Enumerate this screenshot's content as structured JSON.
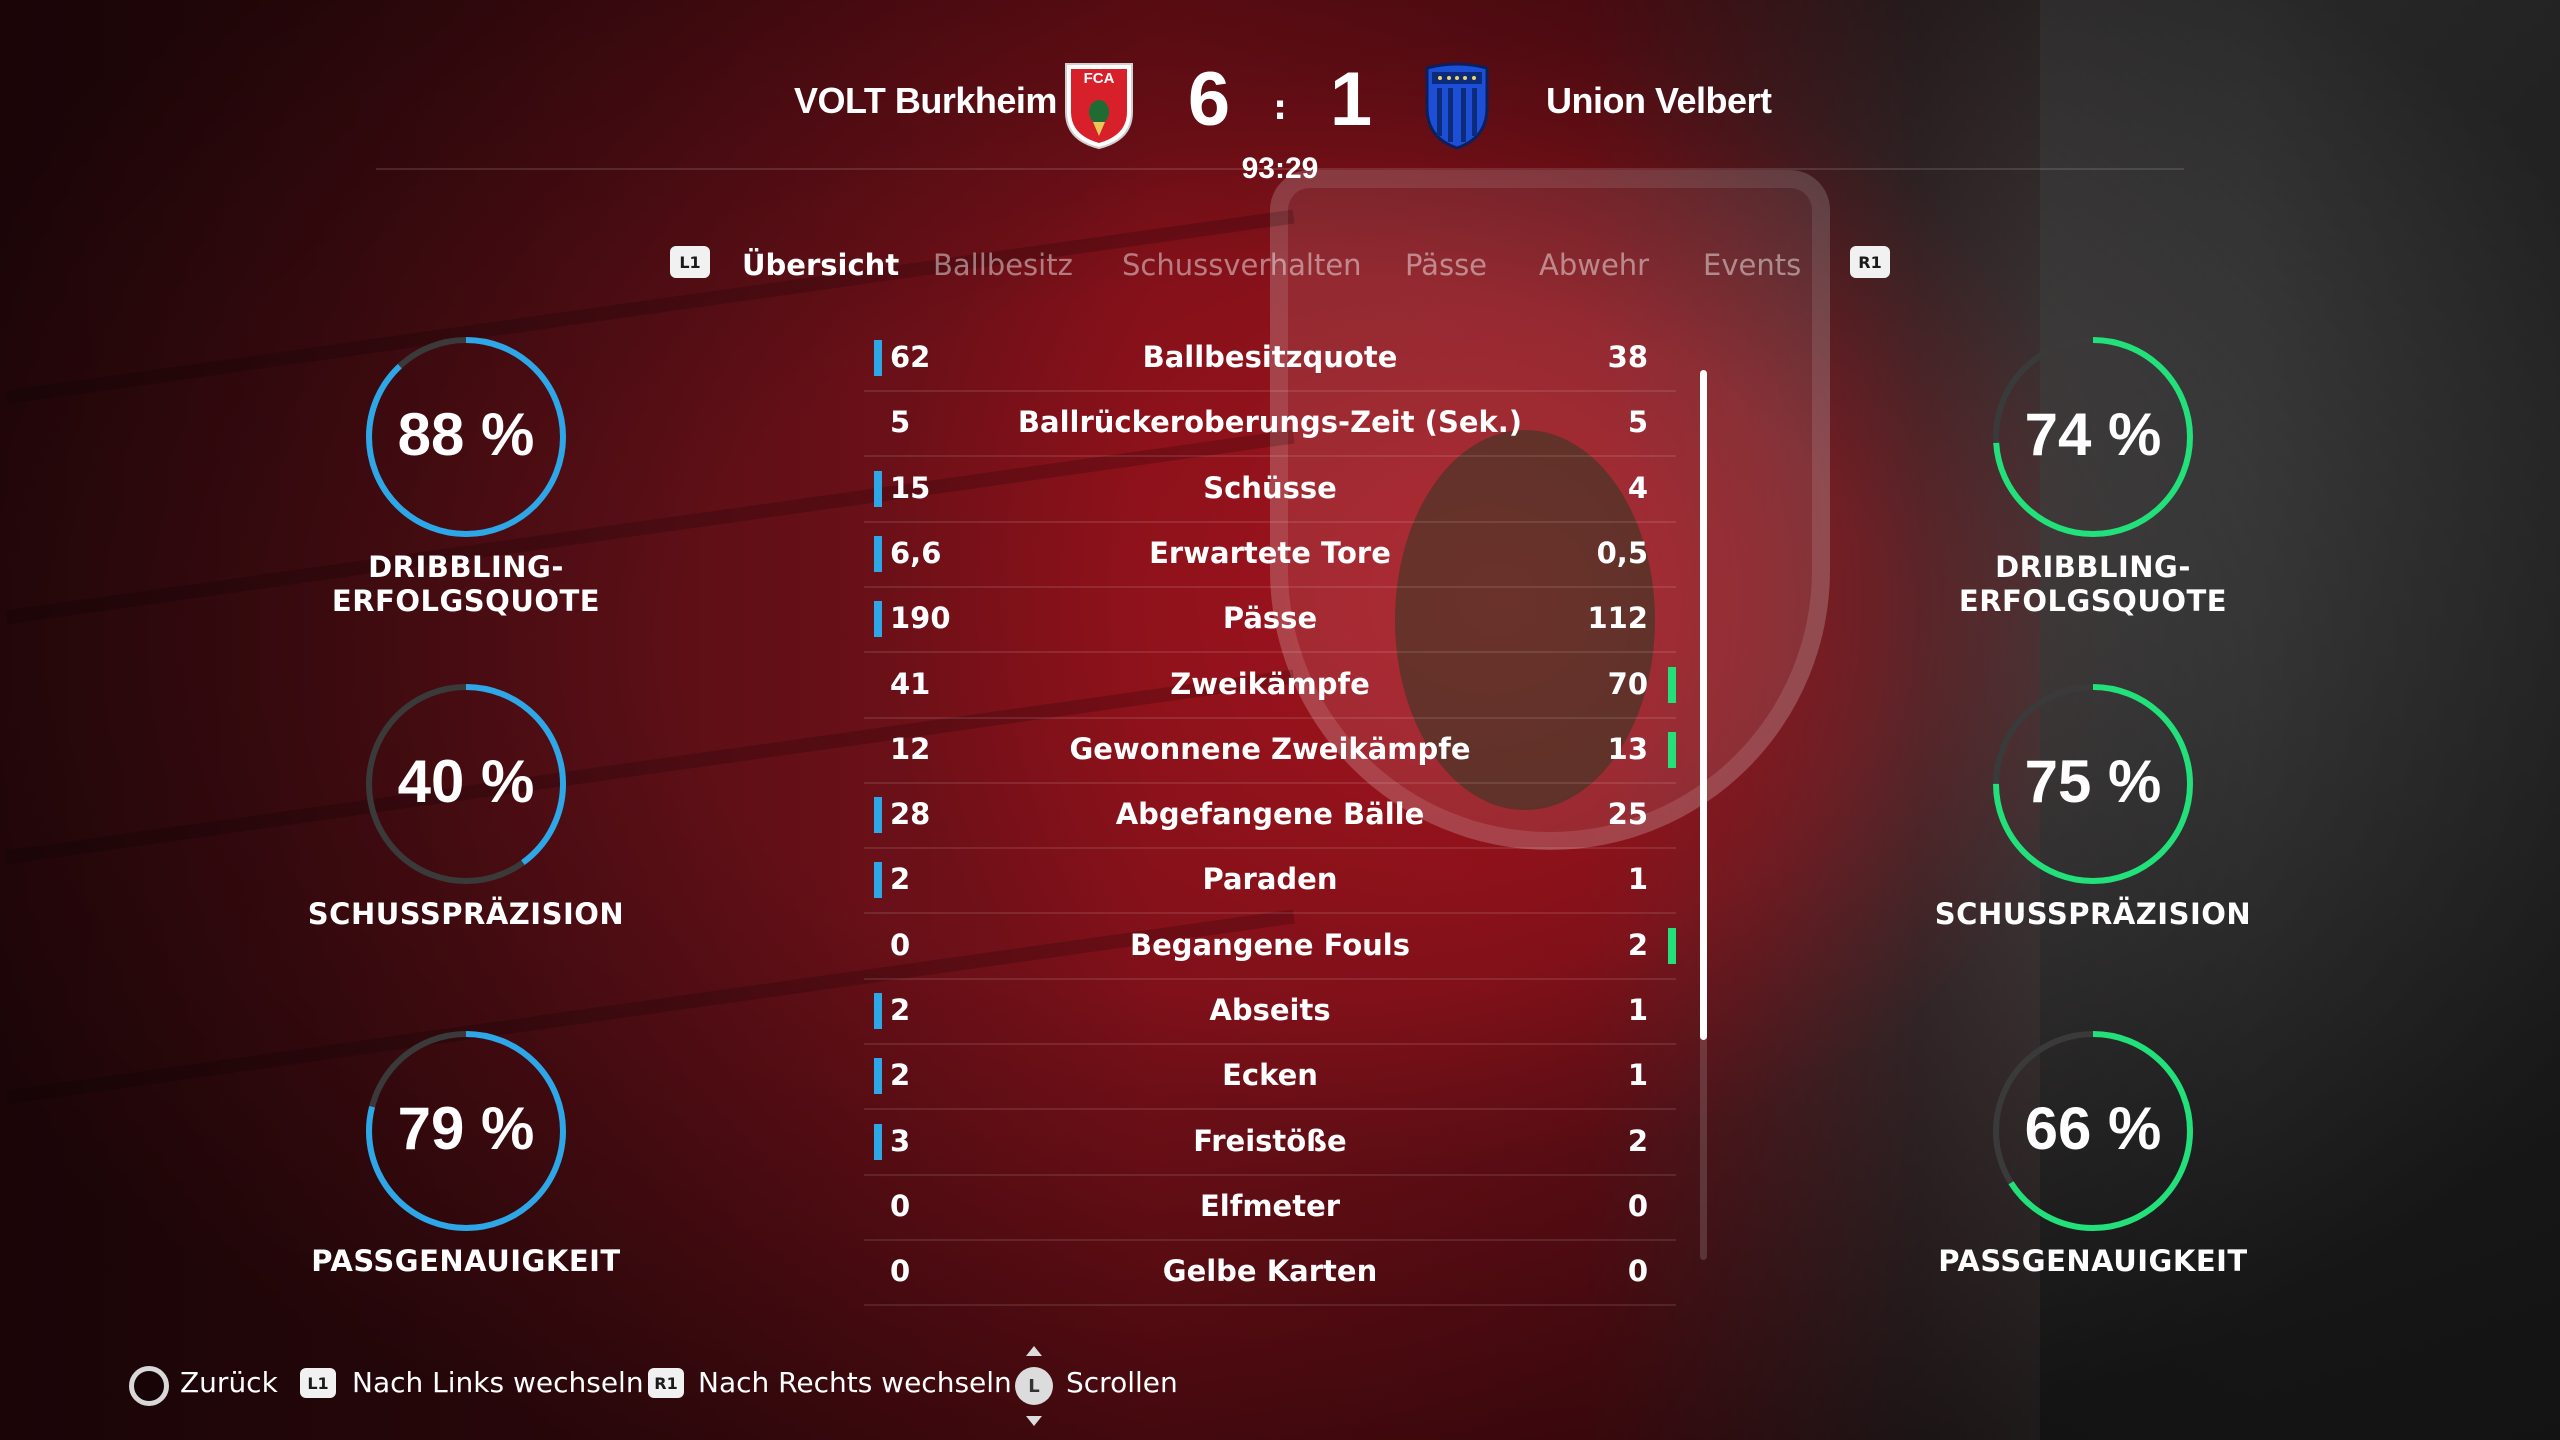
{
  "match": {
    "home_team": "VOLT Burkheim",
    "away_team": "Union Velbert",
    "home_score": "6",
    "away_score": "1",
    "separator": ":",
    "clock": "93:29",
    "home_crest_text": "FCA"
  },
  "tabs": {
    "left_button": "L1",
    "right_button": "R1",
    "items": [
      "Übersicht",
      "Ballbesitz",
      "Schussverhalten",
      "Pässe",
      "Abwehr",
      "Events"
    ],
    "active": "Übersicht"
  },
  "home_gauges": [
    {
      "value": "88 %",
      "percent": 88,
      "label": "DRIBBLING-ERFOLGSQUOTE"
    },
    {
      "value": "40 %",
      "percent": 40,
      "label": "SCHUSSPRÄZISION"
    },
    {
      "value": "79 %",
      "percent": 79,
      "label": "PASSGENAUIGKEIT"
    }
  ],
  "away_gauges": [
    {
      "value": "74 %",
      "percent": 74,
      "label": "DRIBBLING-ERFOLGSQUOTE"
    },
    {
      "value": "75 %",
      "percent": 75,
      "label": "SCHUSSPRÄZISION"
    },
    {
      "value": "66 %",
      "percent": 66,
      "label": "PASSGENAUIGKEIT"
    }
  ],
  "stats": [
    {
      "home": "62",
      "name": "Ballbesitzquote",
      "away": "38",
      "leader": "home"
    },
    {
      "home": "5",
      "name": "Ballrückeroberungs-Zeit (Sek.)",
      "away": "5",
      "leader": "none"
    },
    {
      "home": "15",
      "name": "Schüsse",
      "away": "4",
      "leader": "home"
    },
    {
      "home": "6,6",
      "name": "Erwartete Tore",
      "away": "0,5",
      "leader": "home"
    },
    {
      "home": "190",
      "name": "Pässe",
      "away": "112",
      "leader": "home"
    },
    {
      "home": "41",
      "name": "Zweikämpfe",
      "away": "70",
      "leader": "away"
    },
    {
      "home": "12",
      "name": "Gewonnene Zweikämpfe",
      "away": "13",
      "leader": "away"
    },
    {
      "home": "28",
      "name": "Abgefangene Bälle",
      "away": "25",
      "leader": "home"
    },
    {
      "home": "2",
      "name": "Paraden",
      "away": "1",
      "leader": "home"
    },
    {
      "home": "0",
      "name": "Begangene Fouls",
      "away": "2",
      "leader": "away"
    },
    {
      "home": "2",
      "name": "Abseits",
      "away": "1",
      "leader": "home"
    },
    {
      "home": "2",
      "name": "Ecken",
      "away": "1",
      "leader": "home"
    },
    {
      "home": "3",
      "name": "Freistöße",
      "away": "2",
      "leader": "home"
    },
    {
      "home": "0",
      "name": "Elfmeter",
      "away": "0",
      "leader": "none"
    },
    {
      "home": "0",
      "name": "Gelbe Karten",
      "away": "0",
      "leader": "none"
    }
  ],
  "footer": {
    "back": "Zurück",
    "left_badge": "L1",
    "left": "Nach Links wechseln",
    "right_badge": "R1",
    "right": "Nach Rechts wechseln",
    "stick_badge": "L",
    "scroll": "Scrollen"
  },
  "colors": {
    "home_accent": "#2ea7e8",
    "away_accent": "#22e07a",
    "gauge_track": "#3a3a3a"
  }
}
